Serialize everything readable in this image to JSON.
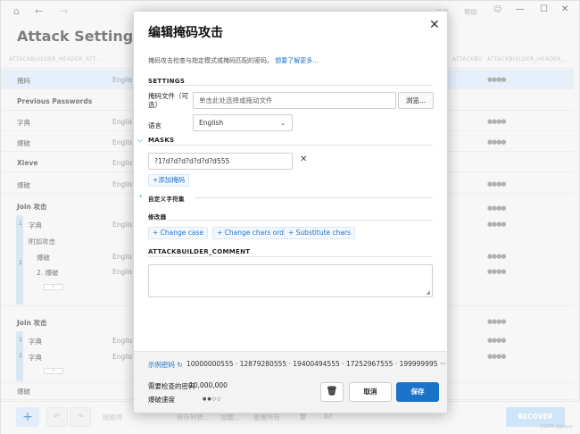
{
  "app": {
    "title": "Attack Settings",
    "help_label": "帮助",
    "extra_label": "工具",
    "column_headers": [
      "ATTACKBUILDER_HEADER_ATT...",
      "ATTACKBUILDER_HEADER_...",
      "ATTACKBUILDER_HEADER_..."
    ],
    "rows": [
      {
        "name": "掩码",
        "lang": "English",
        "bold": false
      },
      {
        "name": "Previous Passwords",
        "lang": "",
        "bold": true
      },
      {
        "name": "字典",
        "lang": "English",
        "bold": false
      },
      {
        "name": "爆破",
        "lang": "English",
        "bold": false
      },
      {
        "name": "Xieve",
        "lang": "English",
        "bold": true
      },
      {
        "name": "爆破",
        "lang": "English",
        "bold": false
      },
      {
        "name": "Join 攻击",
        "lang": "",
        "bold": true
      },
      {
        "name": "字典",
        "lang": "English",
        "bold": false
      },
      {
        "name": "附加攻击",
        "lang": "",
        "bold": false
      },
      {
        "name": "爆破",
        "lang": "English",
        "bold": false
      },
      {
        "name": "2. 爆破",
        "lang": "English",
        "bold": false
      },
      {
        "name": "Join 攻击",
        "lang": "",
        "bold": true
      },
      {
        "name": "字典",
        "lang": "English",
        "bold": false
      },
      {
        "name": "字典",
        "lang": "English",
        "bold": false
      },
      {
        "name": "爆破",
        "lang": "",
        "bold": false
      }
    ],
    "group_numbers": [
      "1",
      "2",
      "1",
      "2"
    ],
    "dots": "●●●●",
    "bottom": {
      "add": "+",
      "sort_label": "按顺序",
      "save_list": "保存列表...",
      "load_label": "加载...",
      "reset_all": "重置所有",
      "all_label": "All",
      "recover": "RECOVER"
    },
    "watermark": "CSDN @jjxyu"
  },
  "modal": {
    "title": "编辑掩码攻击",
    "description": "掩码攻击检查与指定模式或掩码匹配的密码。",
    "learn_more": "想要了解更多...",
    "settings_label": "SETTINGS",
    "mask_file_label": "掩码文件（可选）",
    "mask_file_placeholder": "单击此处选择或拖动文件",
    "browse_label": "浏览...",
    "language_label": "语言",
    "language_value": "English",
    "masks_label": "MASKS",
    "mask_value": "?1?d?d?d?d?d?d?d555",
    "add_mask_label": "+添加掩码",
    "custom_charset_label": "自定义字符集",
    "modifiers_label": "修改器",
    "modifiers": [
      "+ Change case",
      "+ Change chars order",
      "+ Substitute chars"
    ],
    "comment_label": "ATTACKBUILDER_COMMENT",
    "comment_value": "",
    "footer": {
      "sample_label": "示例密码",
      "sample_values": "10000000555 · 12879280555 · 19400494555 · 17252967555 · 199999995 ···",
      "count_label": "需要检查的密码",
      "count_value": "10,000,000",
      "speed_label": "爆破速度",
      "speed_level": 2,
      "speed_max": 4,
      "delete_icon": "trash-icon",
      "cancel_label": "取消",
      "save_label": "保存"
    }
  },
  "colors": {
    "accent": "#1a73c9",
    "selected_row": "#dbe9f7",
    "recover_button": "#b9d7f4"
  }
}
